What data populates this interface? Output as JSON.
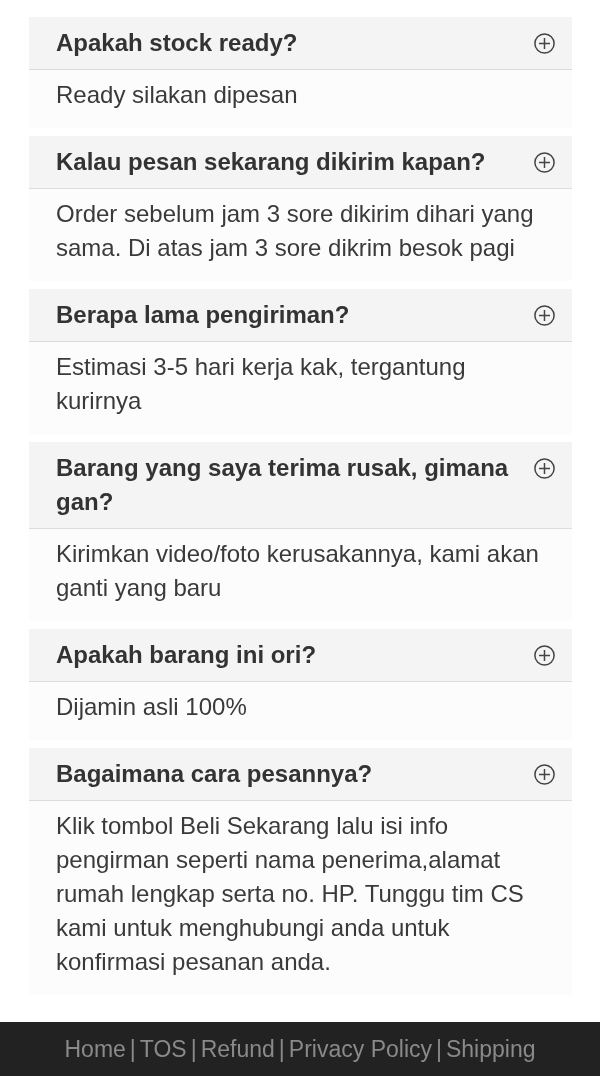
{
  "faq": [
    {
      "question": "Apakah stock ready?",
      "expanded": true,
      "answer": "Ready silakan dipesan"
    },
    {
      "question": "Kalau pesan sekarang dikirim kapan?",
      "expanded": true,
      "answer": "Order sebelum jam 3 sore dikirim dihari yang sama. Di atas jam 3 sore dikrim besok pagi"
    },
    {
      "question": "Berapa lama pengiriman?",
      "expanded": true,
      "answer": "Estimasi 3-5 hari kerja kak, tergantung kurirnya"
    },
    {
      "question": "Barang yang saya terima rusak, gimana gan?",
      "expanded": true,
      "answer": "Kirimkan video/foto kerusakannya, kami akan ganti yang baru"
    },
    {
      "question": "Apakah barang ini ori?",
      "expanded": true,
      "answer": "Dijamin asli 100%"
    },
    {
      "question": "Bagaimana cara pesannya?",
      "expanded": true,
      "answer": "Klik tombol Beli Sekarang lalu isi info pengirman seperti nama penerima,alamat rumah lengkap serta no. HP. Tunggu tim CS kami untuk menghubungi anda untuk konfirmasi pesanan anda."
    }
  ],
  "footer": {
    "separator": "|",
    "links": [
      "Home",
      "TOS",
      "Refund",
      "Privacy Policy",
      "Shipping"
    ]
  }
}
